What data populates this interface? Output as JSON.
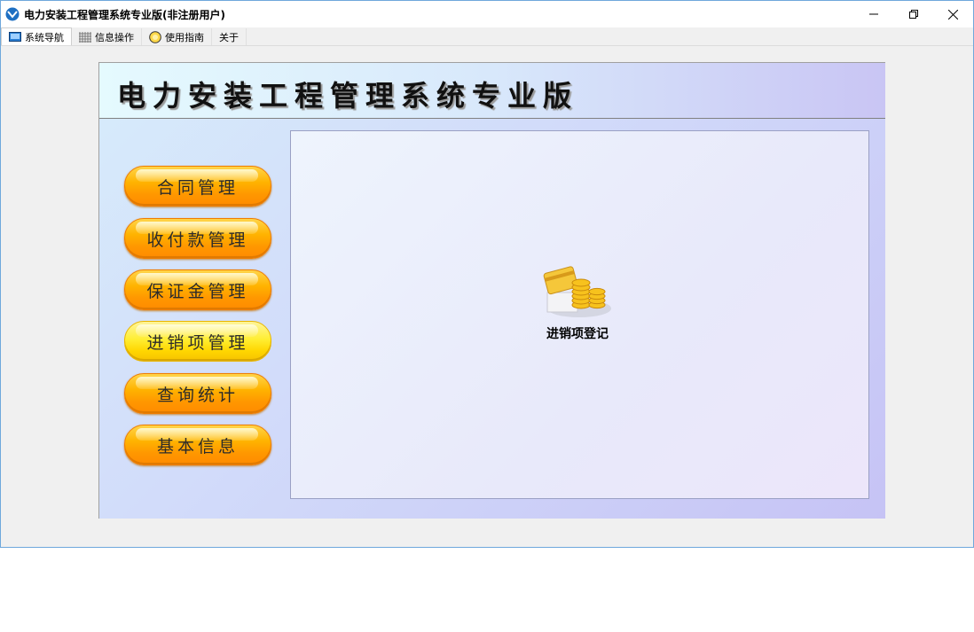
{
  "window": {
    "title": "电力安装工程管理系统专业版(非注册用户)"
  },
  "menu": {
    "tabs": [
      {
        "label": "系统导航",
        "icon": "monitor-icon"
      },
      {
        "label": "信息操作",
        "icon": "grid-icon"
      },
      {
        "label": "使用指南",
        "icon": "help-icon"
      },
      {
        "label": "关于",
        "icon": ""
      }
    ]
  },
  "banner": {
    "title": "电力安装工程管理系统专业版"
  },
  "sidebar": {
    "buttons": [
      {
        "label": "合同管理"
      },
      {
        "label": "收付款管理"
      },
      {
        "label": "保证金管理"
      },
      {
        "label": "进销项管理"
      },
      {
        "label": "查询统计"
      },
      {
        "label": "基本信息"
      }
    ]
  },
  "content": {
    "entry_label": "进销项登记",
    "entry_icon": "coins-card-icon"
  },
  "colors": {
    "button_orange": "#ff9800",
    "button_active": "#ffee33",
    "border_blue": "#6fa8dc"
  }
}
